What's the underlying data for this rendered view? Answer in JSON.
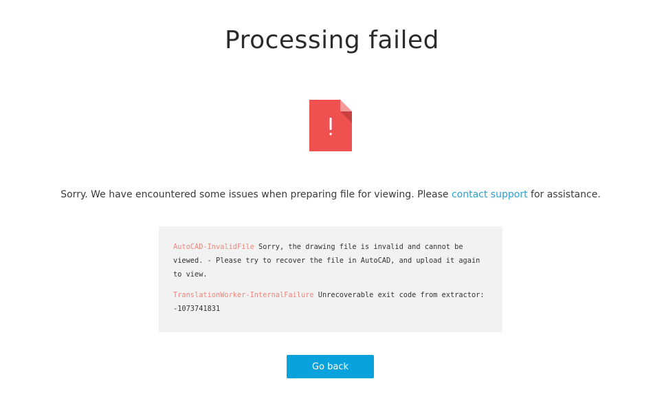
{
  "page": {
    "title": "Processing failed"
  },
  "icon": {
    "name": "file-error-icon",
    "glyph": "!",
    "color": "#ef5350"
  },
  "message": {
    "prefix": "Sorry. We have encountered some issues when preparing file for viewing. Please ",
    "link_text": "contact support",
    "suffix": " for assistance."
  },
  "errors": [
    {
      "code": "AutoCAD-InvalidFile",
      "text": " Sorry, the drawing file is invalid and cannot be viewed. - Please try to recover the file in AutoCAD, and upload it again to view."
    },
    {
      "code": "TranslationWorker-InternalFailure",
      "text": " Unrecoverable exit code from extractor: -1073741831"
    }
  ],
  "actions": {
    "go_back_label": "Go back"
  },
  "colors": {
    "accent": "#0aa2dd",
    "link": "#2b9fd6",
    "error_code": "#f0857c"
  }
}
